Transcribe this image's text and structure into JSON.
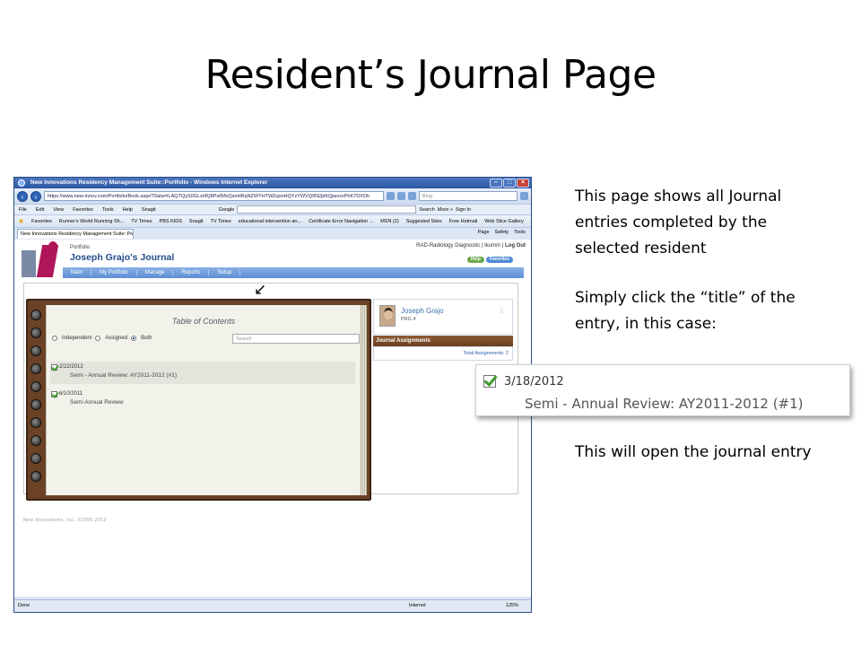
{
  "slide": {
    "title": "Resident’s Journal Page",
    "note1": "This page shows all Journal entries completed by the selected resident",
    "note2": "Simply click the “title” of the entry, in this case:",
    "note3": "This will open the journal entry"
  },
  "browser": {
    "window_title": "New Innovations Residency Management Suite::Portfolio - Windows Internet Explorer",
    "url": "https://www.new-innov.com/Portfolio/Book.aspx?Data=ILAQTQyS0GLshfQ8Ps6MxQxeHRqNZWYHTWZqxnHQYzYWVQ9N2jbKQjwxxxPhK7DXOh",
    "search_placeholder": "Bing",
    "menu": [
      "File",
      "Edit",
      "View",
      "Favorites",
      "Tools",
      "Help"
    ],
    "toolbar_snagit": "Snagit",
    "toolbar_google": "Google",
    "toolbar_search": "Search",
    "toolbar_more": "More »",
    "toolbar_signin": "Sign In",
    "favorites_label": "Favorites",
    "favorites": [
      "Runner's World Running Sh...",
      "TV Times",
      "PBS KIDS",
      "Snagit",
      "TV Times",
      "educational intervention an...",
      "Certificate Error Navigation ...",
      "MSN (2)",
      "Suggested Sites",
      "Free Hotmail",
      "Web Slice Gallery"
    ],
    "tab_label": "New Innovations Residency Management Suite::Portf...",
    "tab_tools": [
      "Page",
      "Safety",
      "Tools"
    ],
    "status_done": "Done",
    "status_zone": "Internet",
    "status_zoom": "125%"
  },
  "site": {
    "breadcrumb": "Portfolio",
    "page_title": "Joseph Grajo's Journal",
    "user_info": "RAD-Radiology Diagnostic | tkumm |",
    "logout": "Log Out",
    "help_btn": "Help",
    "favorites_btn": "Favorites",
    "nav": [
      "Main",
      "My Portfolio",
      "Manage",
      "Reports",
      "Setup"
    ],
    "copyright": "New Innovations, Inc. ©1995-2012"
  },
  "toc": {
    "heading": "Table of Contents",
    "filters": [
      "Independent",
      "Assigned",
      "Both"
    ],
    "selected_filter": "Both",
    "search_placeholder": "Search",
    "entries": [
      {
        "date": "2/22/2012",
        "name": "Semi - Annual Review: AY2011-2012 (#1)"
      },
      {
        "date": "6/10/2011",
        "name": "Semi Annual Review"
      }
    ]
  },
  "profile": {
    "name": "Joseph Grajo",
    "level": "PRG 4",
    "assignments_header": "Journal Assignments",
    "total_assignments": "Total Assignments: 2"
  },
  "callout": {
    "date": "3/18/2012",
    "name": "Semi - Annual Review: AY2011-2012 (#1)"
  },
  "colors": {
    "ie_blue": "#2b56a2",
    "nav_blue": "#5d8ed4",
    "notebook_brown": "#6b4225",
    "title_blue": "#1f4b8c",
    "check_green": "#3d9a2a"
  }
}
